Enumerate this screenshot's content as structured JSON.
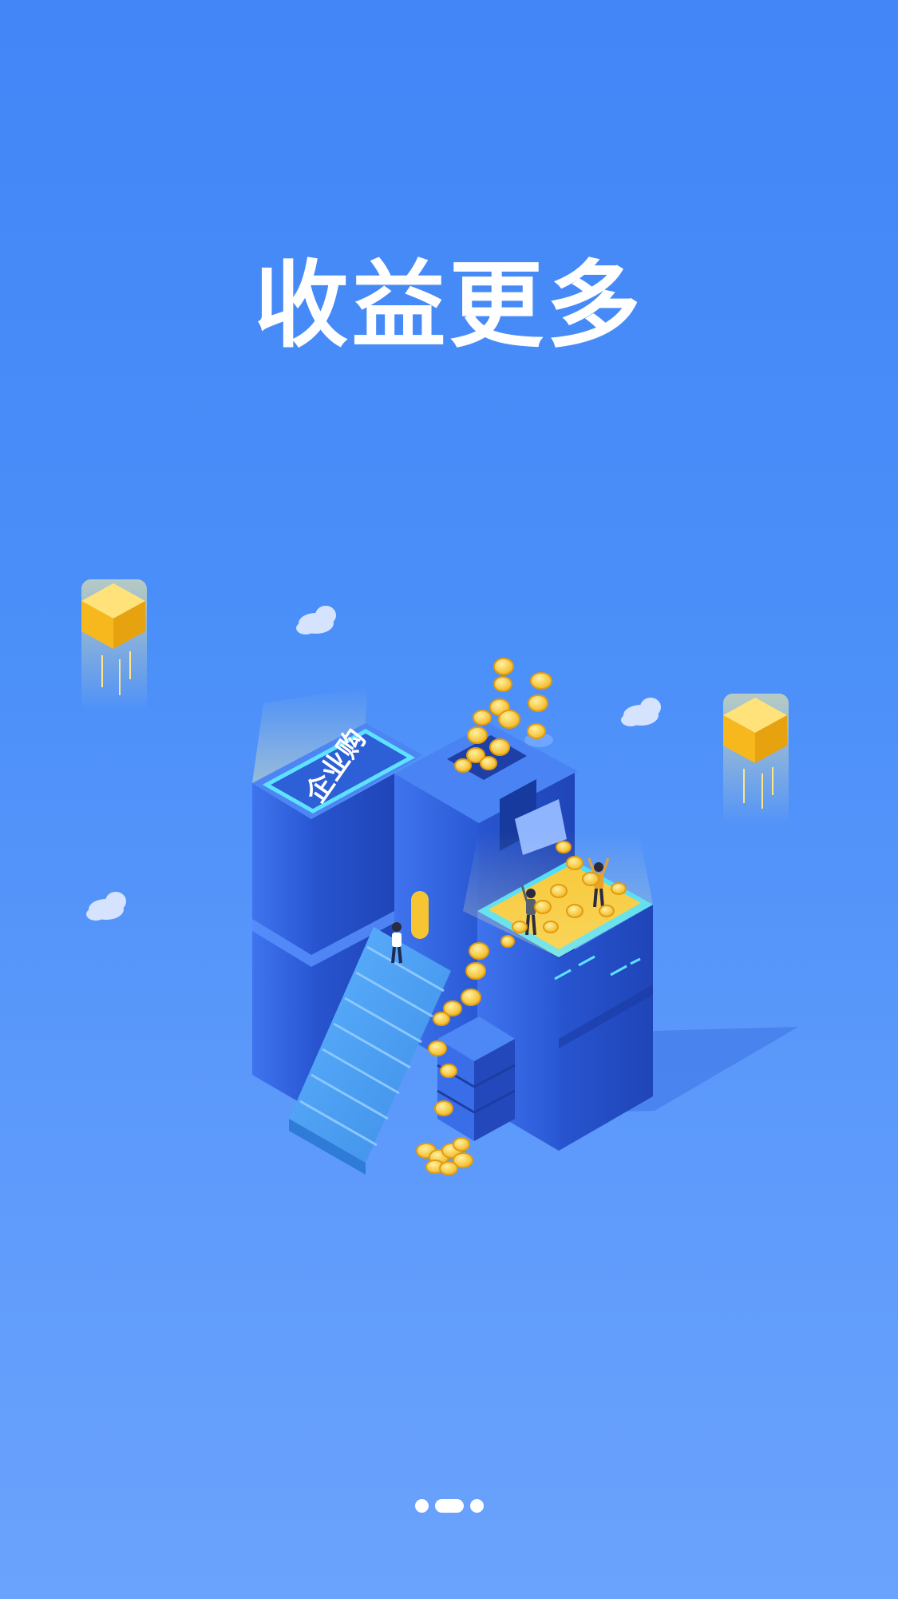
{
  "slide": {
    "headline": "收益更多",
    "logo_text": "企业购",
    "illustration_icon": "isometric-building-coins"
  },
  "pager": {
    "total": 3,
    "active_index": 1
  },
  "colors": {
    "background_top": "#4286f8",
    "background_bottom": "#6aa3fd",
    "building_blue": "#2f5fd8",
    "coin_gold": "#f7c531",
    "cube_yellow": "#fcc81f",
    "text": "#ffffff"
  }
}
